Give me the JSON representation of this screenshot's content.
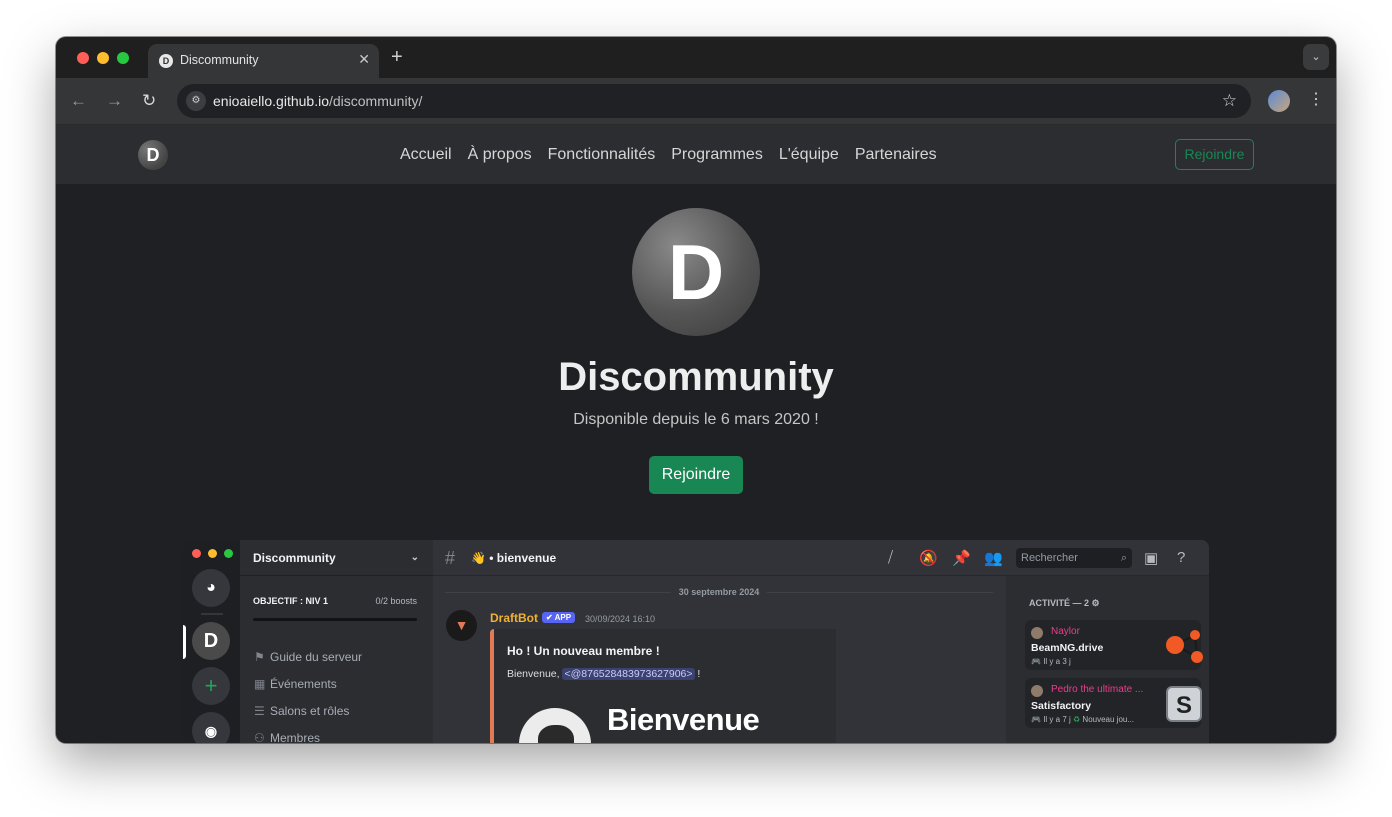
{
  "browser": {
    "tab_title": "Discommunity",
    "tab_favicon": "D",
    "url_host": "enioaiello.github.io",
    "url_path": "/discommunity/"
  },
  "site": {
    "logo_letter": "D",
    "nav": [
      "Accueil",
      "À propos",
      "Fonctionnalités",
      "Programmes",
      "L'équipe",
      "Partenaires"
    ],
    "nav_join": "Rejoindre",
    "hero_logo_letter": "D",
    "hero_title": "Discommunity",
    "hero_subtitle": "Disponible depuis le 6 mars 2020 !",
    "hero_join": "Rejoindre",
    "accent_color": "#198754"
  },
  "discord": {
    "server_name": "Discommunity",
    "server_guild_letter": "D",
    "boost_label": "OBJECTIF : NIV 1",
    "boost_count": "0/2 boosts",
    "channels": [
      {
        "icon": "signpost-icon",
        "label": "Guide du serveur"
      },
      {
        "icon": "calendar-icon",
        "label": "Événements"
      },
      {
        "icon": "list-icon",
        "label": "Salons et rôles"
      },
      {
        "icon": "members-icon",
        "label": "Membres"
      }
    ],
    "channel_name": "👋 • bienvenue",
    "search_placeholder": "Rechercher",
    "date_divider": "30 septembre 2024",
    "message": {
      "author": "DraftBot",
      "badge": "✔ APP",
      "time": "30/09/2024 16:10",
      "embed_title": "Ho ! Un nouveau membre !",
      "embed_text_prefix": "Bienvenue, ",
      "embed_mention": "<@876528483973627906>",
      "embed_text_suffix": " !",
      "image_text": "Bienvenue"
    },
    "activity_title": "ACTIVITÉ — 2",
    "activity": [
      {
        "user": "Naylor",
        "game": "BeamNG.drive",
        "time": "Il y a 3 j",
        "extra": ""
      },
      {
        "user": "Pedro the ultimate ...",
        "game": "Satisfactory",
        "time": "Il y a 7 j",
        "extra": "Nouveau jou..."
      }
    ]
  }
}
